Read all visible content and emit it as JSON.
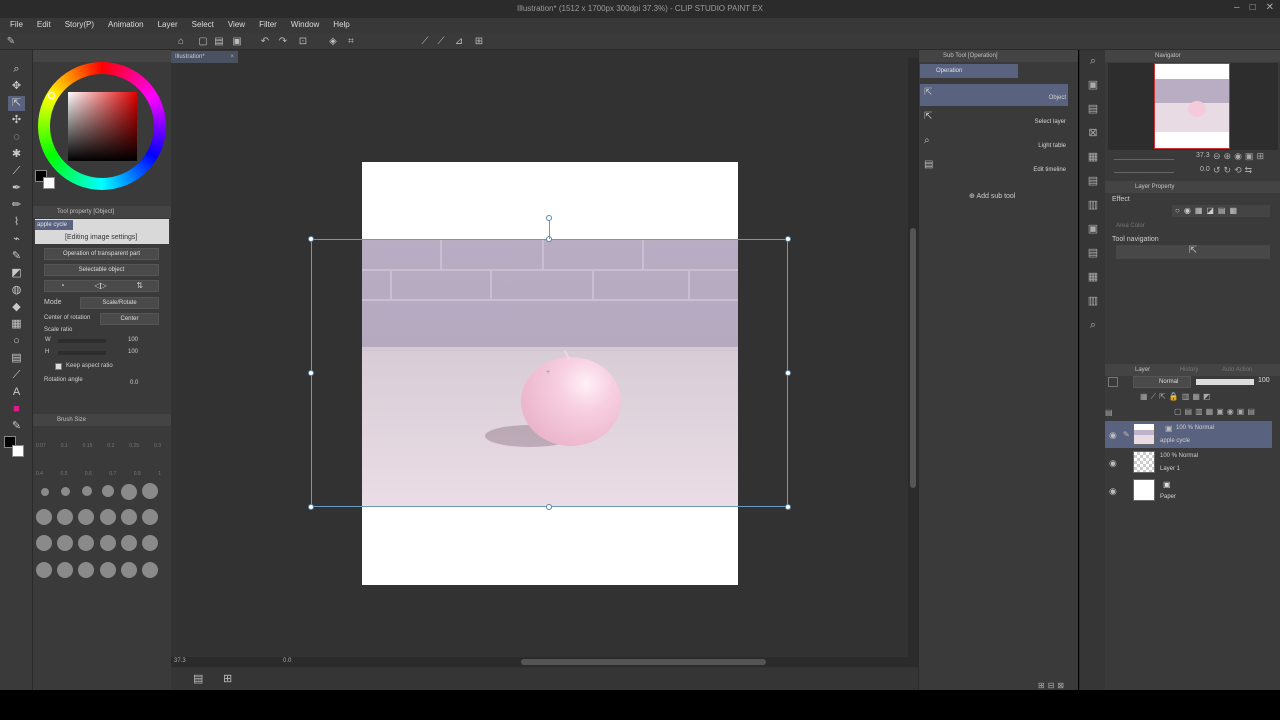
{
  "window": {
    "title": "Illustration* (1512 x 1700px 300dpi 37.3%) - CLIP STUDIO PAINT EX"
  },
  "menu": [
    "File",
    "Edit",
    "Story(P)",
    "Animation",
    "Layer",
    "Select",
    "View",
    "Filter",
    "Window",
    "Help"
  ],
  "document": {
    "tab_label": "Illustration*"
  },
  "tool_property": {
    "header": "Tool property [Object]",
    "layer_name": "apple cycle",
    "editing_label": "[Editing image settings]",
    "transparent_part": "Operation of transparent part",
    "selectable_object": "Selectable object",
    "mode_label": "Mode",
    "mode_value": "Scale/Rotate",
    "center_label": "Center of rotation",
    "center_value": "Center",
    "scale_label": "Scale ratio",
    "w_label": "W",
    "w_value": "100",
    "h_label": "H",
    "h_value": "100",
    "keep_aspect": "Keep aspect ratio",
    "rotation_label": "Rotation angle",
    "rotation_value": "0.0"
  },
  "brush_size": {
    "header": "Brush Size",
    "row1": [
      "0.07",
      "0.1",
      "0.15",
      "0.2",
      "0.25",
      "0.3"
    ],
    "row2": [
      "0.4",
      "0.5",
      "0.6",
      "0.7",
      "0.8",
      "1"
    ]
  },
  "canvas": {
    "zoom": "37.3",
    "rotation": "0.0"
  },
  "sub_tool": {
    "header": "Sub Tool [Operation]",
    "tab": "Operation",
    "items": [
      "Object",
      "Select layer",
      "Light table",
      "Edit timeline"
    ],
    "add_label": "Add sub tool"
  },
  "navigator": {
    "header": "Navigator",
    "zoom": "37.3",
    "angle": "0.0"
  },
  "layer_property": {
    "header": "Layer Property",
    "effect_label": "Effect",
    "area_color": "Area Color",
    "tool_nav": "Tool navigation"
  },
  "layer_panel": {
    "tabs": [
      "Layer",
      "History",
      "Auto Action"
    ],
    "blend_mode": "Normal",
    "opacity": "100",
    "layers": [
      {
        "mode": "100 % Normal",
        "name": "apple cycle",
        "selected": true
      },
      {
        "mode": "100 % Normal",
        "name": "Layer 1",
        "selected": false
      },
      {
        "mode": "",
        "name": "Paper",
        "selected": false
      }
    ]
  },
  "colors": {
    "accent": "#59627e",
    "selection": "#6a9ac0",
    "foreground": "#000000",
    "background": "#ffffff"
  }
}
